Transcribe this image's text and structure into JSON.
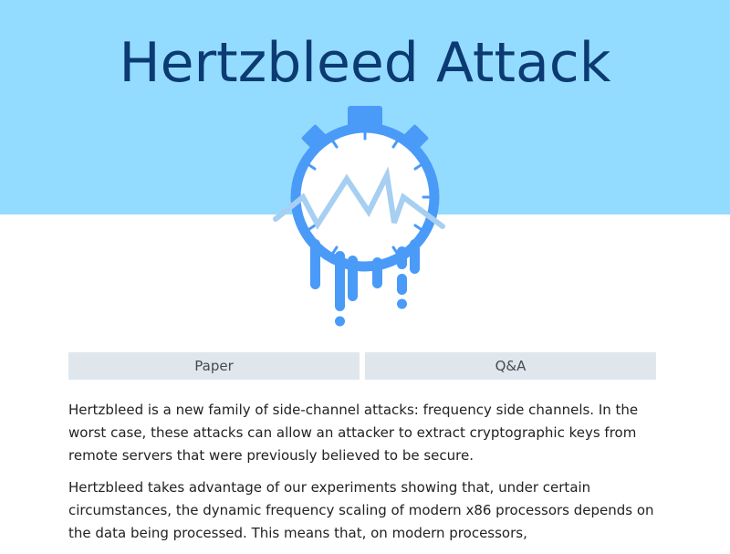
{
  "header": {
    "title": "Hertzbleed Attack",
    "background_color": "#94dcff",
    "title_color": "#0c3a72"
  },
  "logo": {
    "icon": "melting-stopwatch-icon",
    "primary_color": "#4a9af8",
    "wave_color": "#a6cff1"
  },
  "nav": {
    "buttons": [
      {
        "label": "Paper"
      },
      {
        "label": "Q&A"
      }
    ]
  },
  "content": {
    "paragraphs": [
      "Hertzbleed is a new family of side-channel attacks: frequency side channels. In the worst case, these attacks can allow an attacker to extract cryptographic keys from remote servers that were previously believed to be secure.",
      "Hertzbleed takes advantage of our experiments showing that, under certain circumstances, the dynamic frequency scaling of modern x86 processors depends on the data being processed. This means that, on modern processors,"
    ]
  }
}
